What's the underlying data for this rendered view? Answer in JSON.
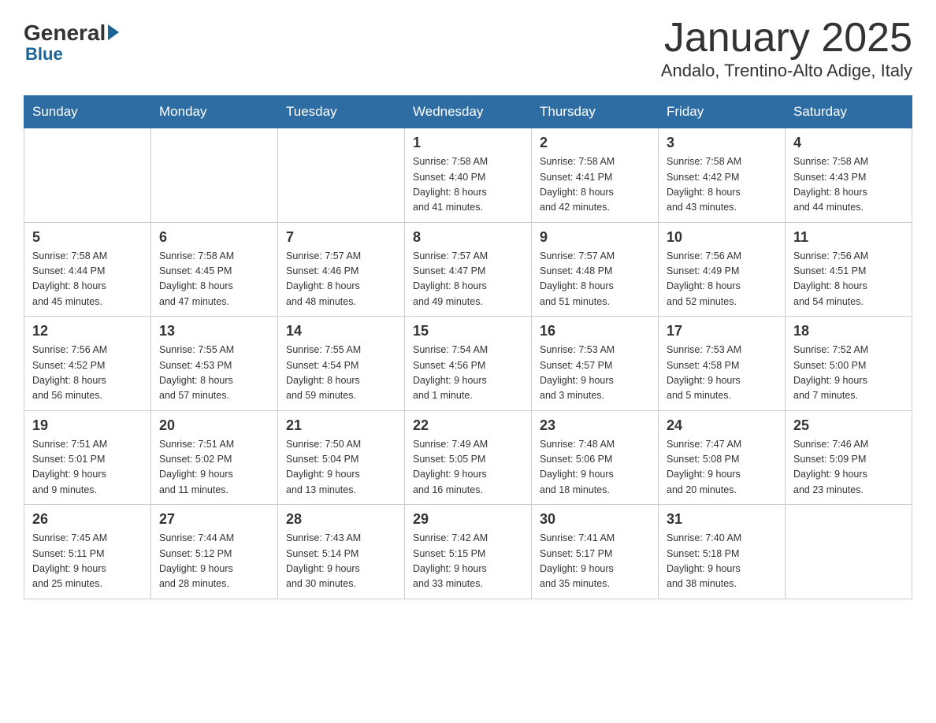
{
  "logo": {
    "general": "General",
    "blue": "Blue"
  },
  "title": "January 2025",
  "subtitle": "Andalo, Trentino-Alto Adige, Italy",
  "days": [
    "Sunday",
    "Monday",
    "Tuesday",
    "Wednesday",
    "Thursday",
    "Friday",
    "Saturday"
  ],
  "weeks": [
    [
      {
        "date": "",
        "info": ""
      },
      {
        "date": "",
        "info": ""
      },
      {
        "date": "",
        "info": ""
      },
      {
        "date": "1",
        "info": "Sunrise: 7:58 AM\nSunset: 4:40 PM\nDaylight: 8 hours\nand 41 minutes."
      },
      {
        "date": "2",
        "info": "Sunrise: 7:58 AM\nSunset: 4:41 PM\nDaylight: 8 hours\nand 42 minutes."
      },
      {
        "date": "3",
        "info": "Sunrise: 7:58 AM\nSunset: 4:42 PM\nDaylight: 8 hours\nand 43 minutes."
      },
      {
        "date": "4",
        "info": "Sunrise: 7:58 AM\nSunset: 4:43 PM\nDaylight: 8 hours\nand 44 minutes."
      }
    ],
    [
      {
        "date": "5",
        "info": "Sunrise: 7:58 AM\nSunset: 4:44 PM\nDaylight: 8 hours\nand 45 minutes."
      },
      {
        "date": "6",
        "info": "Sunrise: 7:58 AM\nSunset: 4:45 PM\nDaylight: 8 hours\nand 47 minutes."
      },
      {
        "date": "7",
        "info": "Sunrise: 7:57 AM\nSunset: 4:46 PM\nDaylight: 8 hours\nand 48 minutes."
      },
      {
        "date": "8",
        "info": "Sunrise: 7:57 AM\nSunset: 4:47 PM\nDaylight: 8 hours\nand 49 minutes."
      },
      {
        "date": "9",
        "info": "Sunrise: 7:57 AM\nSunset: 4:48 PM\nDaylight: 8 hours\nand 51 minutes."
      },
      {
        "date": "10",
        "info": "Sunrise: 7:56 AM\nSunset: 4:49 PM\nDaylight: 8 hours\nand 52 minutes."
      },
      {
        "date": "11",
        "info": "Sunrise: 7:56 AM\nSunset: 4:51 PM\nDaylight: 8 hours\nand 54 minutes."
      }
    ],
    [
      {
        "date": "12",
        "info": "Sunrise: 7:56 AM\nSunset: 4:52 PM\nDaylight: 8 hours\nand 56 minutes."
      },
      {
        "date": "13",
        "info": "Sunrise: 7:55 AM\nSunset: 4:53 PM\nDaylight: 8 hours\nand 57 minutes."
      },
      {
        "date": "14",
        "info": "Sunrise: 7:55 AM\nSunset: 4:54 PM\nDaylight: 8 hours\nand 59 minutes."
      },
      {
        "date": "15",
        "info": "Sunrise: 7:54 AM\nSunset: 4:56 PM\nDaylight: 9 hours\nand 1 minute."
      },
      {
        "date": "16",
        "info": "Sunrise: 7:53 AM\nSunset: 4:57 PM\nDaylight: 9 hours\nand 3 minutes."
      },
      {
        "date": "17",
        "info": "Sunrise: 7:53 AM\nSunset: 4:58 PM\nDaylight: 9 hours\nand 5 minutes."
      },
      {
        "date": "18",
        "info": "Sunrise: 7:52 AM\nSunset: 5:00 PM\nDaylight: 9 hours\nand 7 minutes."
      }
    ],
    [
      {
        "date": "19",
        "info": "Sunrise: 7:51 AM\nSunset: 5:01 PM\nDaylight: 9 hours\nand 9 minutes."
      },
      {
        "date": "20",
        "info": "Sunrise: 7:51 AM\nSunset: 5:02 PM\nDaylight: 9 hours\nand 11 minutes."
      },
      {
        "date": "21",
        "info": "Sunrise: 7:50 AM\nSunset: 5:04 PM\nDaylight: 9 hours\nand 13 minutes."
      },
      {
        "date": "22",
        "info": "Sunrise: 7:49 AM\nSunset: 5:05 PM\nDaylight: 9 hours\nand 16 minutes."
      },
      {
        "date": "23",
        "info": "Sunrise: 7:48 AM\nSunset: 5:06 PM\nDaylight: 9 hours\nand 18 minutes."
      },
      {
        "date": "24",
        "info": "Sunrise: 7:47 AM\nSunset: 5:08 PM\nDaylight: 9 hours\nand 20 minutes."
      },
      {
        "date": "25",
        "info": "Sunrise: 7:46 AM\nSunset: 5:09 PM\nDaylight: 9 hours\nand 23 minutes."
      }
    ],
    [
      {
        "date": "26",
        "info": "Sunrise: 7:45 AM\nSunset: 5:11 PM\nDaylight: 9 hours\nand 25 minutes."
      },
      {
        "date": "27",
        "info": "Sunrise: 7:44 AM\nSunset: 5:12 PM\nDaylight: 9 hours\nand 28 minutes."
      },
      {
        "date": "28",
        "info": "Sunrise: 7:43 AM\nSunset: 5:14 PM\nDaylight: 9 hours\nand 30 minutes."
      },
      {
        "date": "29",
        "info": "Sunrise: 7:42 AM\nSunset: 5:15 PM\nDaylight: 9 hours\nand 33 minutes."
      },
      {
        "date": "30",
        "info": "Sunrise: 7:41 AM\nSunset: 5:17 PM\nDaylight: 9 hours\nand 35 minutes."
      },
      {
        "date": "31",
        "info": "Sunrise: 7:40 AM\nSunset: 5:18 PM\nDaylight: 9 hours\nand 38 minutes."
      },
      {
        "date": "",
        "info": ""
      }
    ]
  ]
}
